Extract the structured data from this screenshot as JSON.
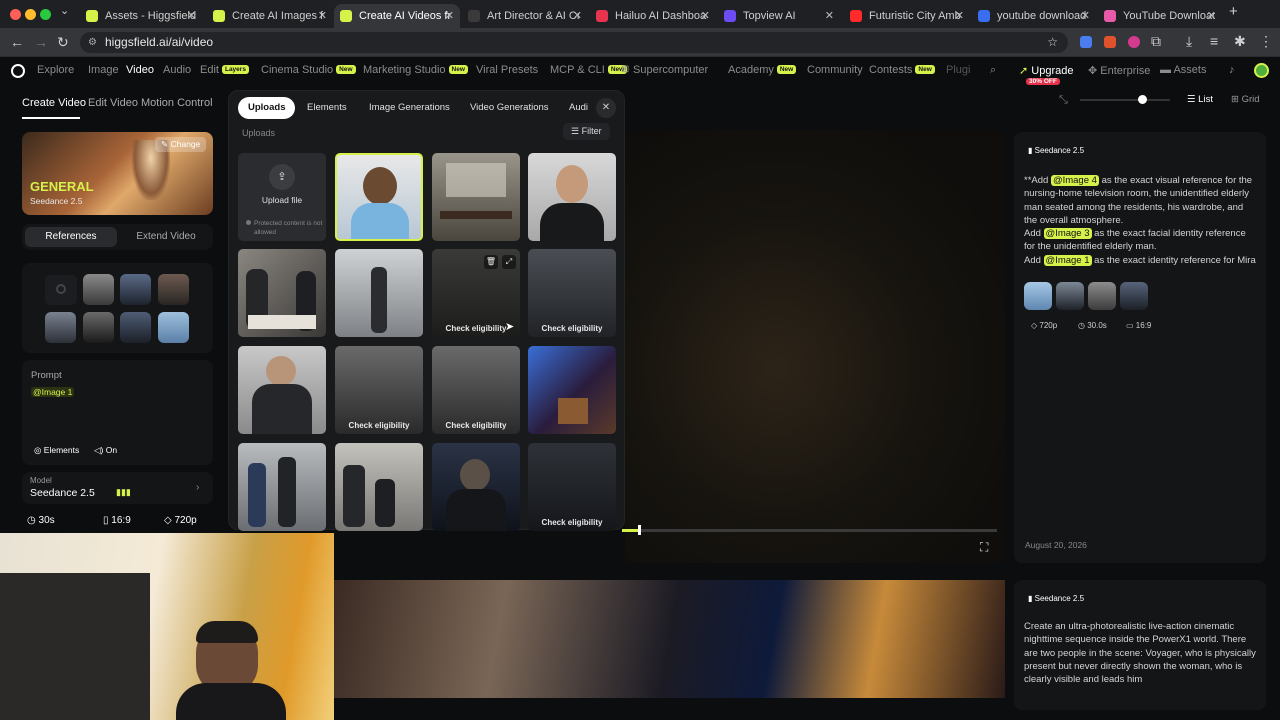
{
  "browser": {
    "tabs": [
      {
        "title": "Assets - Higgsfield",
        "fav": "#d6f24a",
        "active": false
      },
      {
        "title": "Create AI Images fro",
        "fav": "#d6f24a",
        "active": false
      },
      {
        "title": "Create AI Videos from",
        "fav": "#d6f24a",
        "active": true
      },
      {
        "title": "Art Director & AI Cre",
        "fav": "#3a3a3a",
        "active": false
      },
      {
        "title": "Hailuo AI Dashboard",
        "fav": "#e8344e",
        "active": false
      },
      {
        "title": "Topview AI",
        "fav": "#6b4cf5",
        "active": false
      },
      {
        "title": "Futuristic City Ambie",
        "fav": "#ff2a2a",
        "active": false
      },
      {
        "title": "youtube download o",
        "fav": "#3a6df0",
        "active": false
      },
      {
        "title": "YouTube Downloader",
        "fav": "#e85aa8",
        "active": false
      }
    ],
    "new_tab": "+",
    "url": "higgsfield.ai/ai/video"
  },
  "site_nav": {
    "items": [
      "Explore",
      "Image",
      "Video",
      "Audio",
      "Edit",
      "Cinema Studio",
      "Marketing Studio",
      "Viral Presets",
      "MCP & CLI",
      "Supercomputer",
      "Academy",
      "Community",
      "Contests",
      "Plugi"
    ],
    "badges": {
      "edit": "Layers",
      "cinema": "New",
      "marketing": "New",
      "mcp": "New",
      "academy": "New",
      "contests": "New"
    },
    "upgrade": "Upgrade",
    "upgrade_badge": "30% OFF",
    "enterprise": "Enterprise",
    "assets": "Assets"
  },
  "left_panel": {
    "tabs": [
      "Create Video",
      "Edit Video",
      "Motion Control"
    ],
    "hero_title": "GENERAL",
    "hero_sub": "Seedance 2.5",
    "change": "Change",
    "subtabs": [
      "References",
      "Extend Video"
    ],
    "prompt_label": "Prompt",
    "prompt_tag": "@Image 1",
    "elements_label": "Elements",
    "on_label": "On",
    "model_label": "Model",
    "model_value": "Seedance 2.5",
    "duration": "30s",
    "aspect": "16:9",
    "quality": "720p"
  },
  "uploads": {
    "tabs": [
      "Uploads",
      "Elements",
      "Image Generations",
      "Video Generations",
      "Audi"
    ],
    "section": "Uploads",
    "filter": "Filter",
    "upload_file": "Upload file",
    "protected_note": "Protected content is not allowed",
    "check_label": "Check eligibility"
  },
  "view": {
    "list": "List",
    "grid": "Grid"
  },
  "results": [
    {
      "model": "Seedance 2.5",
      "line1_pre": "**Add",
      "tag1": "@Image 4",
      "line1_post": " as the exact visual reference for the nursing-home television room, the unidentified elderly man seated among the residents, his wardrobe, and the overall atmosphere.",
      "line2_pre": "Add",
      "tag2": "@Image 3",
      "line2_post": " as the exact facial identity reference for the unidentified elderly man.",
      "line3_pre": "Add",
      "tag3": "@Image 1",
      "line3_post": " as the exact identity reference for Mira",
      "quality": "720p",
      "duration": "30.0s",
      "aspect": "16:9",
      "date": "August 20, 2026"
    },
    {
      "model": "Seedance 2.5",
      "text": "Create an ultra-photorealistic live-action cinematic nighttime sequence inside the PowerX1 world. There are two people in the scene: Voyager, who is physically present but never directly shown the woman, who is clearly visible and leads him"
    }
  ]
}
